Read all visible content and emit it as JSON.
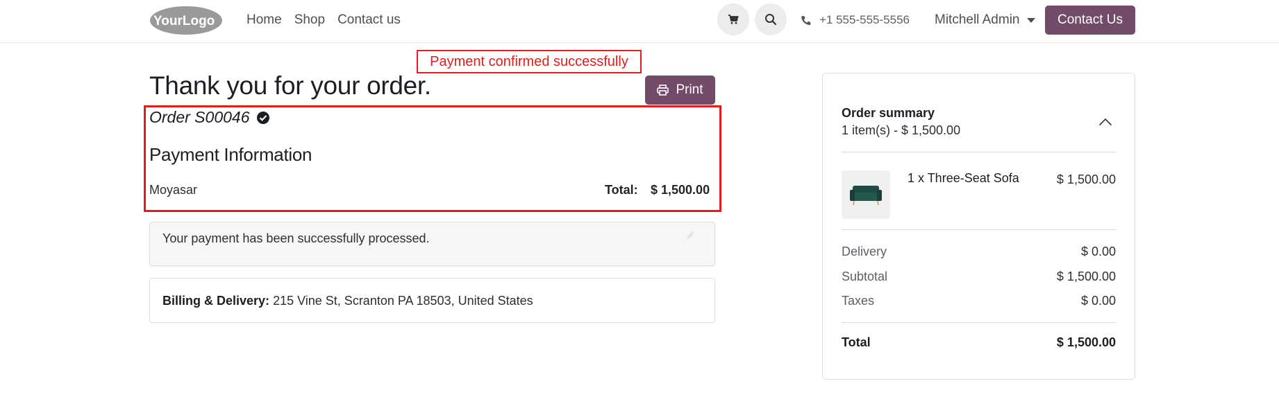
{
  "brand": {
    "logo_text": "YourLogo",
    "accent": "#714b67",
    "highlight": "#e21b1b"
  },
  "nav": {
    "items": [
      "Home",
      "Shop",
      "Contact us"
    ]
  },
  "header": {
    "phone": "+1 555-555-5556",
    "user": "Mitchell Admin",
    "contact_button": "Contact Us",
    "cart_icon": "cart-icon",
    "search_icon": "search-icon"
  },
  "main": {
    "annotation": "Payment confirmed successfully",
    "title": "Thank you for your order.",
    "print_label": "Print",
    "order_name": "Order S00046",
    "payment_heading": "Payment Information",
    "provider": "Moyasar",
    "total_label": "Total:",
    "total_value": "$ 1,500.00",
    "message": "Your payment has been successfully processed.",
    "address_label": "Billing & Delivery:",
    "address": "215 Vine St, Scranton PA 18503, United States"
  },
  "summary": {
    "title": "Order summary",
    "subtitle": "1 item(s) -  $ 1,500.00",
    "item": {
      "name": "1 x Three-Seat Sofa",
      "price": "$ 1,500.00"
    },
    "rows": [
      {
        "label": "Delivery",
        "value": "$ 0.00"
      },
      {
        "label": "Subtotal",
        "value": "$ 1,500.00"
      },
      {
        "label": "Taxes",
        "value": "$ 0.00"
      }
    ],
    "total_label": "Total",
    "total_value": "$ 1,500.00"
  }
}
